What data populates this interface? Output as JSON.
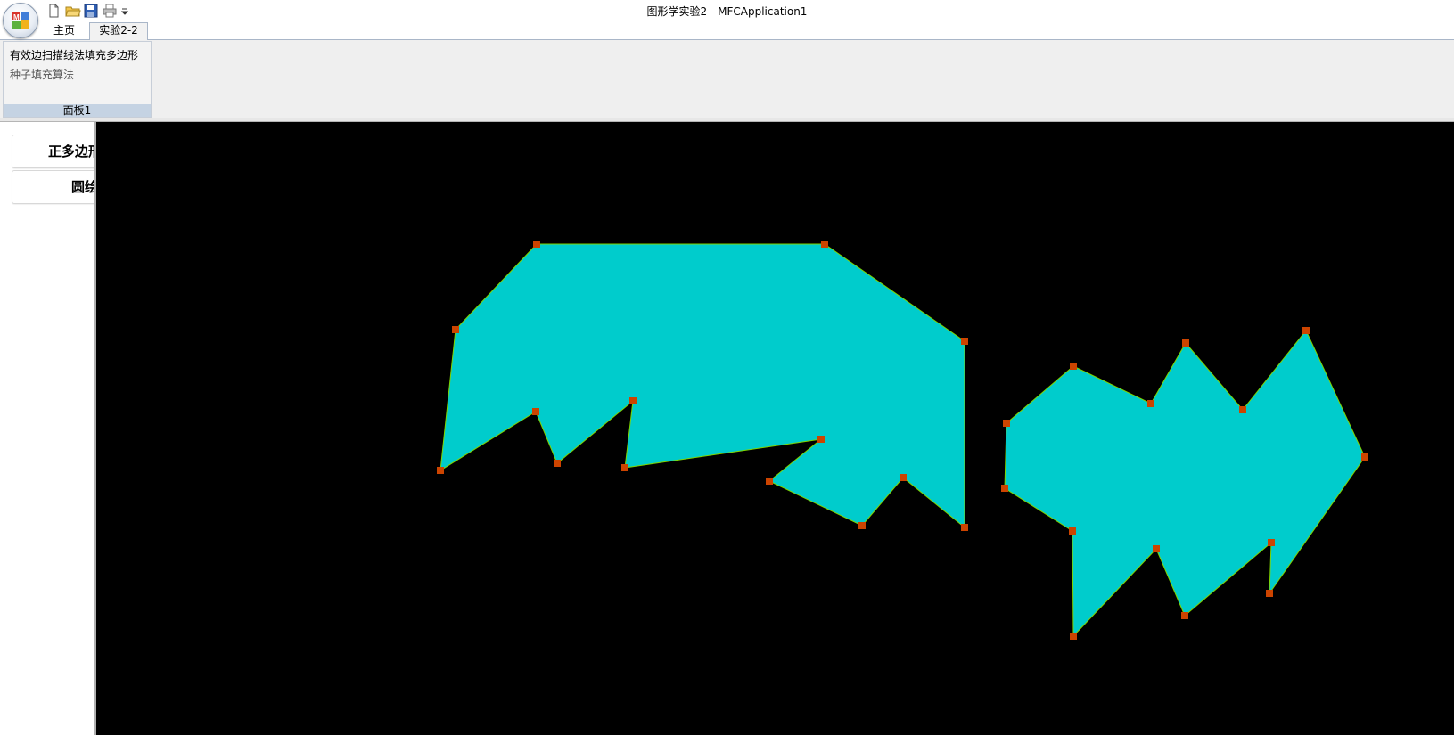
{
  "window": {
    "title": "图形学实验2 - MFCApplication1"
  },
  "quick_access": {
    "icons": [
      "new-file-icon",
      "open-folder-icon",
      "save-icon",
      "print-icon",
      "customize-dropdown-icon"
    ]
  },
  "tabs": [
    {
      "label": "主页",
      "active": false
    },
    {
      "label": "实验2-2",
      "active": true
    }
  ],
  "ribbon": {
    "panel": {
      "caption": "面板1",
      "items": [
        {
          "label": "有效边扫描线法填充多边形",
          "enabled": true
        },
        {
          "label": "种子填充算法",
          "enabled": false
        }
      ]
    }
  },
  "side_pane": {
    "buttons": [
      {
        "label": "正多边形"
      },
      {
        "label": "圆绘制"
      }
    ]
  },
  "canvas": {
    "background": "#000000",
    "fill_color": "#00cccc",
    "edge_color": "#7fd400",
    "vertex_color": "#cc4400"
  }
}
